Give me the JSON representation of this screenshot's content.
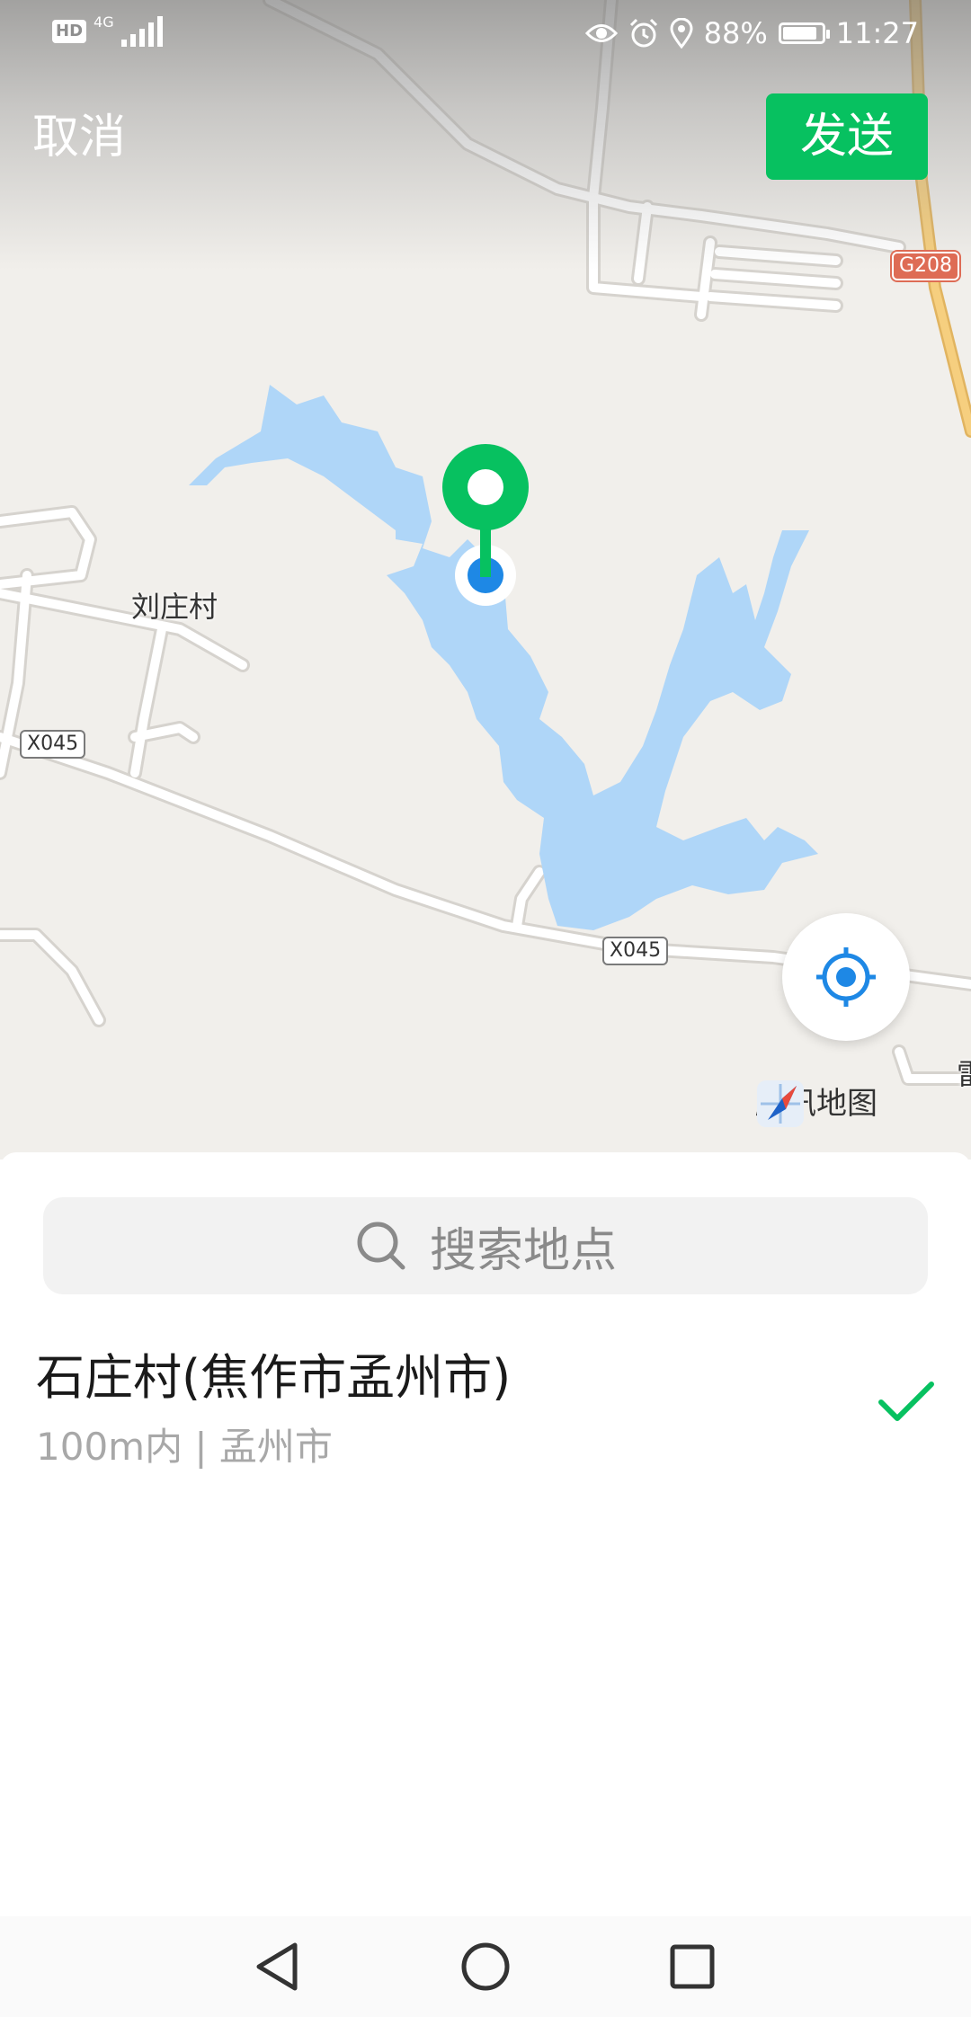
{
  "status_bar": {
    "hd": "HD",
    "network": "4G",
    "battery": "88%",
    "battery_level": 0.88,
    "time": "11:27",
    "icons": [
      "eye-icon",
      "alarm-icon",
      "location-icon",
      "battery-icon"
    ]
  },
  "top_bar": {
    "cancel_label": "取消",
    "send_label": "发送"
  },
  "map": {
    "labels": {
      "village": "刘庄村",
      "edge": "雷"
    },
    "road_badges": {
      "national": "G208",
      "county_west": "X045",
      "county_south": "X045"
    },
    "brand": "腾讯地图",
    "colors": {
      "land": "#f1efeb",
      "water": "#afd6f8",
      "road": "#ffffff",
      "highway": "#f6cf7f",
      "pin": "#07c160",
      "current_location": "#1e88e5"
    }
  },
  "search": {
    "placeholder": "搜索地点"
  },
  "results": [
    {
      "title": "石庄村(焦作市孟州市)",
      "subtitle": "100m内 | 孟州市",
      "selected": true
    }
  ],
  "accent_color": "#07c160",
  "nav": {
    "icons": [
      "back-icon",
      "home-icon",
      "recents-icon"
    ]
  }
}
